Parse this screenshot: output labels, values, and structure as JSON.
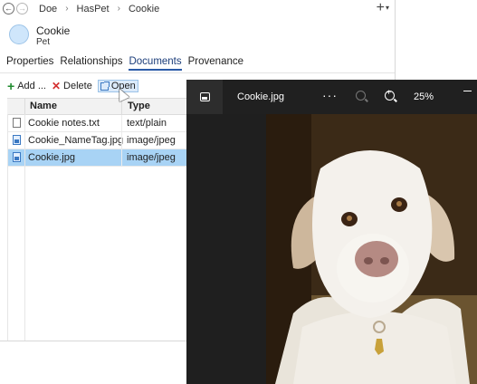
{
  "nav": {
    "back_icon": "arrow-left-circle-icon",
    "forward_icon": "arrow-right-circle-icon",
    "breadcrumbs": [
      "Doe",
      "HasPet",
      "Cookie"
    ],
    "separator": "›",
    "add_icon": "+",
    "add_caret": "▾"
  },
  "entity": {
    "name": "Cookie",
    "type": "Pet"
  },
  "tabs": [
    {
      "label": "Properties"
    },
    {
      "label": "Relationships"
    },
    {
      "label": "Documents",
      "active": true
    },
    {
      "label": "Provenance"
    }
  ],
  "toolbar": {
    "add_label": "Add ...",
    "delete_label": "Delete",
    "open_label": "Open"
  },
  "table": {
    "columns": [
      "Name",
      "Type"
    ],
    "rows": [
      {
        "name": "Cookie notes.txt",
        "type": "text/plain",
        "icon": "text-file-icon"
      },
      {
        "name": "Cookie_NameTag.jpg",
        "type": "image/jpeg",
        "icon": "image-file-icon"
      },
      {
        "name": "Cookie.jpg",
        "type": "image/jpeg",
        "icon": "image-file-icon",
        "selected": true
      }
    ]
  },
  "viewer": {
    "title": "Cookie.jpg",
    "more": "···",
    "zoom": "25%",
    "gallery_icon": "gallery-icon",
    "photo_subject": "white dog lying down"
  },
  "colors": {
    "accent": "#2a5aa8",
    "selection": "#a8d3f5",
    "viewer_bg": "#1f1f1f",
    "add_green": "#1f8a2e",
    "delete_red": "#d32f2f"
  }
}
